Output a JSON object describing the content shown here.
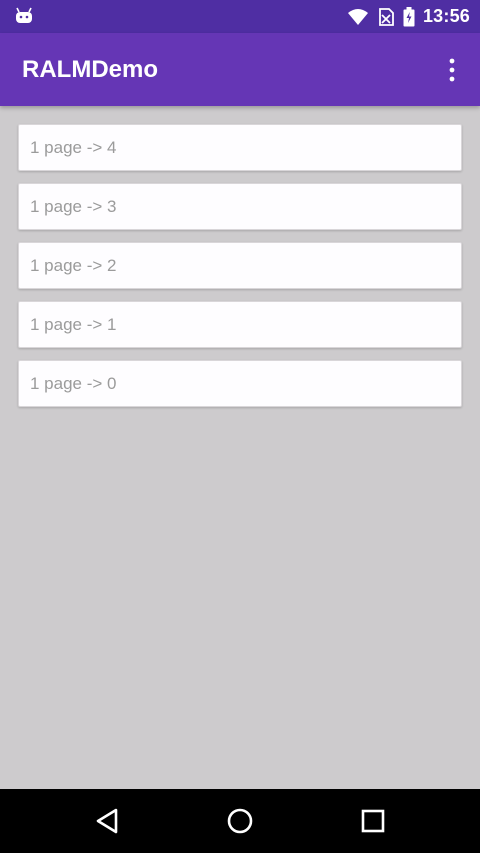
{
  "status_bar": {
    "time": "13:56",
    "left_icon": "android-icon",
    "icons": [
      "wifi-icon",
      "no-sim-icon",
      "battery-icon"
    ]
  },
  "app_bar": {
    "title": "RALMDemo",
    "overflow_icon": "more-vert-icon"
  },
  "list": {
    "items": [
      {
        "label": "1 page -> 4"
      },
      {
        "label": "1 page -> 3"
      },
      {
        "label": "1 page -> 2"
      },
      {
        "label": "1 page -> 1"
      },
      {
        "label": "1 page -> 0"
      }
    ]
  },
  "nav_bar": {
    "buttons": [
      "back-icon",
      "home-icon",
      "recents-icon"
    ]
  },
  "colors": {
    "status_bar": "#4f2ea3",
    "app_bar": "#6536b5",
    "background": "#cdcbcd",
    "card": "#fefdff"
  }
}
